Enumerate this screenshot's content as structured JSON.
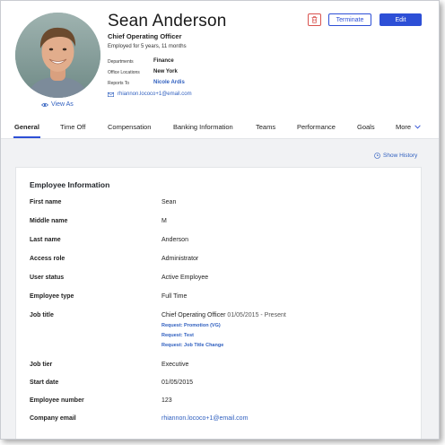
{
  "profile": {
    "name": "Sean Anderson",
    "job_title": "Chief Operating Officer",
    "tenure": "Employed for 5 years, 11 months",
    "meta": [
      {
        "label": "Departments",
        "value": "Finance"
      },
      {
        "label": "Office Locations",
        "value": "New York"
      },
      {
        "label": "Reports To",
        "value": "Nicole Ardis"
      }
    ],
    "email": "rhiannon.lococo+1@email.com",
    "view_as": "View As"
  },
  "actions": {
    "terminate": "Terminate",
    "edit": "Edit",
    "accent_color": "#2d4fd6",
    "danger_color": "#d9534f"
  },
  "tabs": [
    {
      "label": "General",
      "active": true
    },
    {
      "label": "Time Off"
    },
    {
      "label": "Compensation"
    },
    {
      "label": "Banking Information"
    },
    {
      "label": "Teams"
    },
    {
      "label": "Performance"
    },
    {
      "label": "Goals"
    },
    {
      "label": "More"
    }
  ],
  "show_history": "Show History",
  "employee_info": {
    "title": "Employee Information",
    "rows": [
      {
        "label": "First name",
        "value": "Sean"
      },
      {
        "label": "Middle name",
        "value": "M"
      },
      {
        "label": "Last name",
        "value": "Anderson"
      },
      {
        "label": "Access role",
        "value": "Administrator"
      },
      {
        "label": "User status",
        "value": "Active Employee"
      },
      {
        "label": "Employee type",
        "value": "Full Time"
      },
      {
        "label": "Job title",
        "value": "Chief Operating Officer",
        "value_date": "01/05/2015 - Present",
        "requests": [
          "Request: Promotion (VG)",
          "Request: Test",
          "Request: Job Title Change"
        ]
      },
      {
        "label": "Job tier",
        "value": "Executive"
      },
      {
        "label": "Start date",
        "value": "01/05/2015"
      },
      {
        "label": "Employee number",
        "value": "123"
      },
      {
        "label": "Company email",
        "value": "rhiannon.lococo+1@email.com"
      }
    ]
  }
}
